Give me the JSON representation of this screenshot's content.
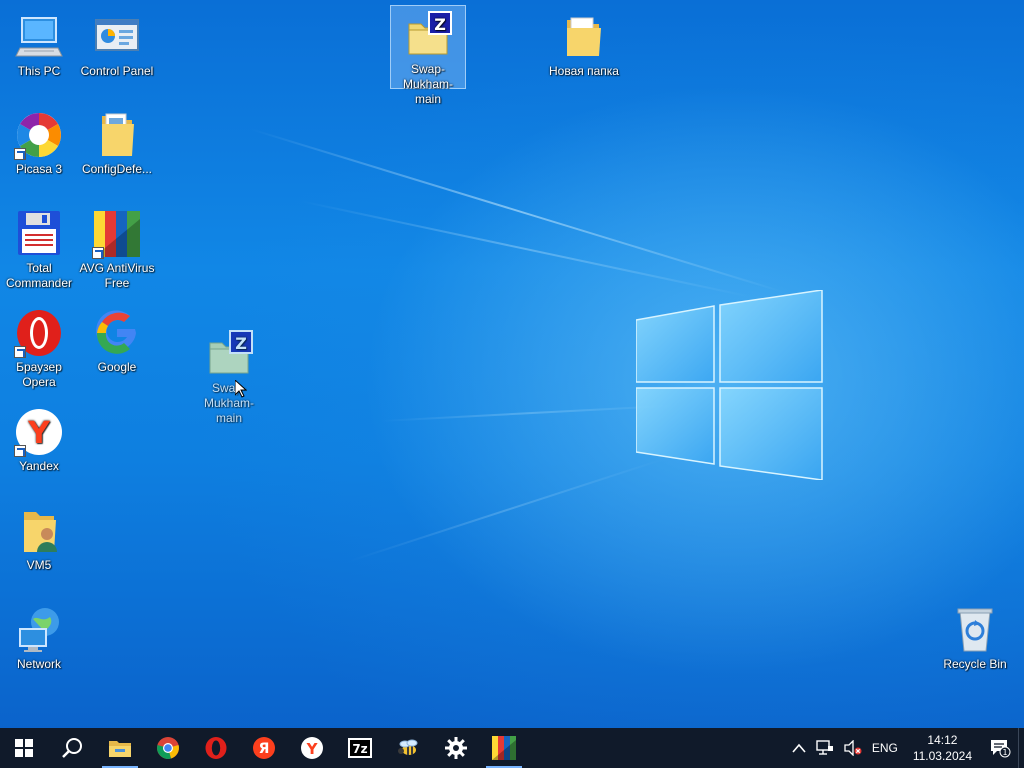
{
  "desktop": {
    "icons": [
      {
        "id": "this-pc",
        "label": "This PC"
      },
      {
        "id": "control-panel",
        "label": "Control Panel"
      },
      {
        "id": "swap-zip-top",
        "label": "Swap-Mukham-main"
      },
      {
        "id": "new-folder",
        "label": "Новая папка"
      },
      {
        "id": "picasa",
        "label": "Picasa 3"
      },
      {
        "id": "configdefe",
        "label": "ConfigDefe..."
      },
      {
        "id": "total-commander",
        "label": "Total Commander"
      },
      {
        "id": "avg",
        "label": "AVG AntiVirus Free"
      },
      {
        "id": "opera",
        "label": "Браузер Opera"
      },
      {
        "id": "google",
        "label": "Google"
      },
      {
        "id": "swap-zip-drag",
        "label": "Swap-Mukham-main"
      },
      {
        "id": "yandex",
        "label": "Yandex"
      },
      {
        "id": "vm5",
        "label": "VM5"
      },
      {
        "id": "network",
        "label": "Network"
      },
      {
        "id": "recycle-bin",
        "label": "Recycle Bin"
      }
    ]
  },
  "taskbar": {
    "apps": [
      {
        "name": "start",
        "icon": "windows-logo-icon"
      },
      {
        "name": "search",
        "icon": "search-icon"
      },
      {
        "name": "file-explorer",
        "icon": "folder-icon"
      },
      {
        "name": "chrome",
        "icon": "chrome-icon"
      },
      {
        "name": "opera",
        "icon": "opera-icon"
      },
      {
        "name": "yandex-browser",
        "icon": "yandex-browser-icon"
      },
      {
        "name": "yandex",
        "icon": "yandex-icon"
      },
      {
        "name": "7zip",
        "icon": "7zip-icon"
      },
      {
        "name": "app-bee",
        "icon": "bee-icon"
      },
      {
        "name": "settings",
        "icon": "gear-icon"
      },
      {
        "name": "avg",
        "icon": "avg-icon"
      }
    ],
    "tray": {
      "language": "ENG",
      "time": "14:12",
      "date": "11.03.2024",
      "notification_count": "1"
    }
  },
  "colors": {
    "taskbar_bg": "#101a2a",
    "accent": "#78b4ff",
    "desktop_blue": "#0a6fd6"
  }
}
